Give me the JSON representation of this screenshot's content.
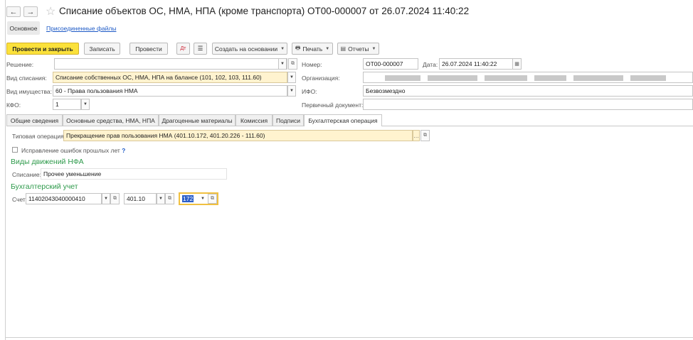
{
  "window": {
    "title": "Списание объектов ОС, НМА, НПА (кроме транспорта) ОТ00-000007 от 26.07.2024 11:40:22",
    "back_symbol": "←",
    "forward_symbol": "→",
    "favorite_symbol": "☆"
  },
  "form_tabs": [
    {
      "label": "Основное"
    },
    {
      "label": "Присоединенные файлы"
    }
  ],
  "toolbar": {
    "post_close": "Провести и закрыть",
    "save": "Записать",
    "post": "Провести",
    "create_based": "Создать на основании",
    "print": "Печать",
    "reports": "Отчеты"
  },
  "fields": {
    "decision": {
      "label": "Решение:",
      "value": ""
    },
    "writeoff_type": {
      "label": "Вид списания:",
      "value": "Списание собственных ОС, НМА, НПА на балансе (101, 102, 103, 111.60)"
    },
    "property_type": {
      "label": "Вид имущества:",
      "value": "60 - Права пользования НМА"
    },
    "kfo": {
      "label": "КФО:",
      "value": "1"
    },
    "number": {
      "label": "Номер:",
      "value": "ОТ00-000007"
    },
    "date": {
      "label": "Дата:",
      "value": "26.07.2024 11:40:22"
    },
    "organization": {
      "label": "Организация:",
      "value": ""
    },
    "ifo": {
      "label": "ИФО:",
      "value": "Безвозмездно"
    },
    "primary_doc": {
      "label": "Первичный документ:",
      "value": ""
    }
  },
  "tabs": [
    {
      "label": "Общие сведения"
    },
    {
      "label": "Основные средства, НМА, НПА"
    },
    {
      "label": "Драгоценные материалы"
    },
    {
      "label": "Комиссия"
    },
    {
      "label": "Подписи"
    },
    {
      "label": "Бухгалтерская операция"
    }
  ],
  "accounting": {
    "typical_op_label": "Типовая операция:",
    "typical_op_value": "Прекращение прав пользования НМА (401.10.172, 401.20.226 - 111.60)",
    "fix_errors_label": "Исправление ошибок прошлых лет",
    "help_symbol": "?",
    "nfa_section": "Виды движений НФА",
    "writeoff_label": "Списание:",
    "writeoff_value": "Прочее уменьшение",
    "bu_section": "Бухгалтерский учет",
    "account_label": "Счет:",
    "account1": "11402043040000410",
    "account2": "401.10",
    "account3": "172"
  },
  "colors": {
    "primary_button": "#fbe13a",
    "highlight_field": "#fff3cf",
    "section_header": "#2e9a4b",
    "link": "#1c59c6"
  }
}
